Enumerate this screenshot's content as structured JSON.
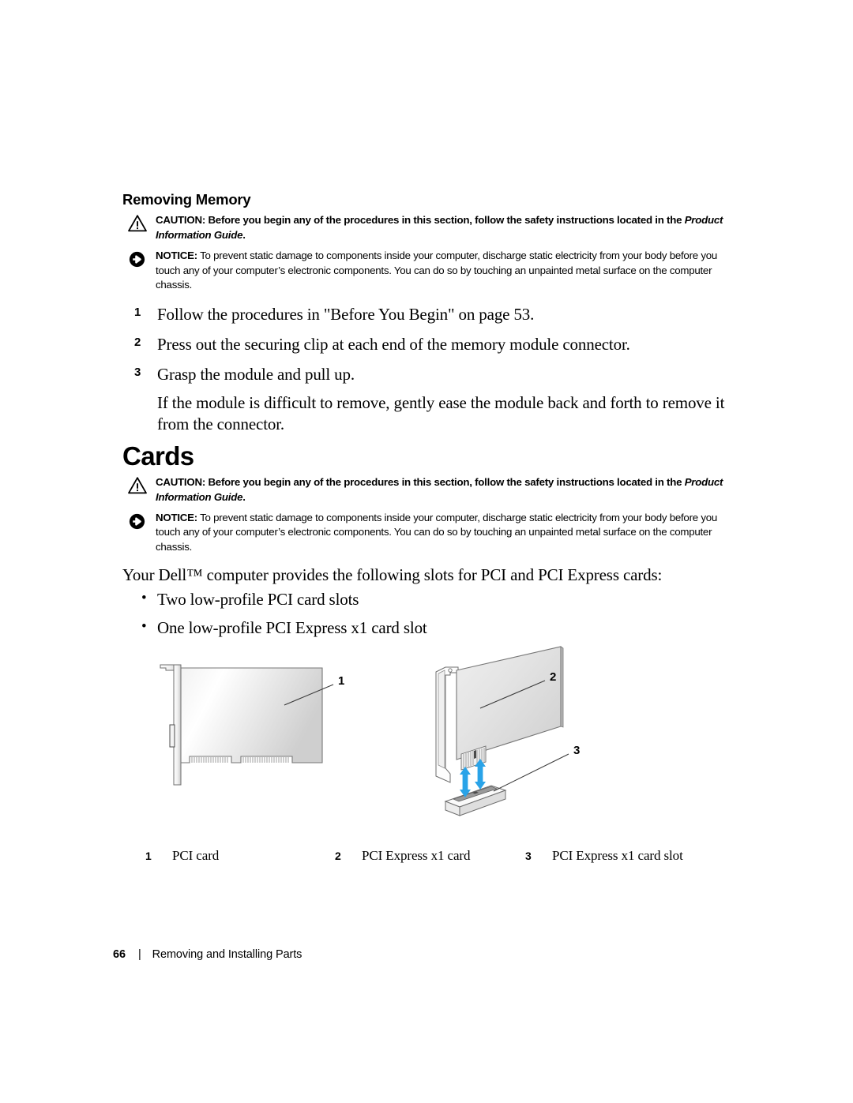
{
  "document": {
    "section_title": "Removing Memory",
    "chapter_title": "Cards"
  },
  "admonitions": {
    "caution_label": "CAUTION:",
    "caution_text": " Before you begin any of the procedures in this section, follow the safety instructions located in the ",
    "caution_guide": "Product Information Guide",
    "caution_period": ".",
    "notice_label": "NOTICE:",
    "notice_text": " To prevent static damage to components inside your computer, discharge static electricity from your body before you touch any of your computer’s electronic components. You can do so by touching an unpainted metal surface on the computer chassis.",
    "caution_icon": "warning-triangle-icon",
    "notice_icon": "arrow-circle-icon"
  },
  "steps": [
    {
      "num": "1",
      "text": "Follow the procedures in \"Before You Begin\" on page 53."
    },
    {
      "num": "2",
      "text": "Press out the securing clip at each end of the memory module connector."
    },
    {
      "num": "3",
      "text": "Grasp the module and pull up."
    }
  ],
  "step_note": "If the module is difficult to remove, gently ease the module back and forth to remove it from the connector.",
  "cards": {
    "intro": "Your Dell™ computer provides the following slots for PCI and PCI Express cards:",
    "bullet_marker": "•",
    "bullets": [
      "Two low-profile PCI card slots",
      "One low-profile PCI Express x1 card slot"
    ]
  },
  "figure": {
    "labels": {
      "one": "1",
      "two": "2",
      "three": "3"
    },
    "callouts": [
      {
        "num": "1",
        "text": "PCI card"
      },
      {
        "num": "2",
        "text": "PCI Express x1 card"
      },
      {
        "num": "3",
        "text": "PCI Express x1 card slot"
      }
    ],
    "colors": {
      "arrow_blue": "#29a3e8",
      "card_face_light": "#ffffff",
      "card_face_dark": "#d9d9d9",
      "outline": "#6b6b6b"
    }
  },
  "footer": {
    "page_number": "66",
    "separator": "|",
    "title": "Removing and Installing Parts"
  }
}
